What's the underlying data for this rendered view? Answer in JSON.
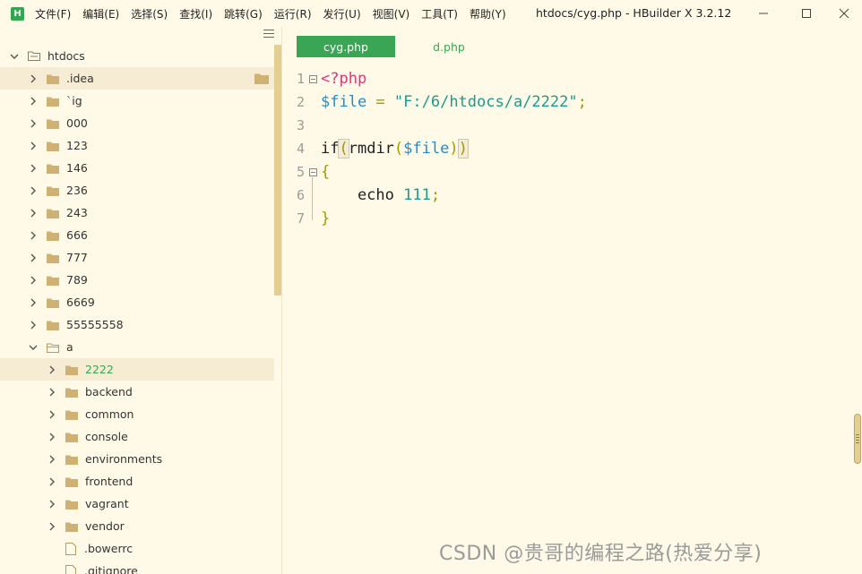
{
  "app": {
    "logo_letter": "H",
    "window_title": "htdocs/cyg.php - HBuilder X 3.2.12",
    "accent_color": "#3aa655"
  },
  "menu": [
    {
      "label": "文件(F)"
    },
    {
      "label": "编辑(E)"
    },
    {
      "label": "选择(S)"
    },
    {
      "label": "查找(I)"
    },
    {
      "label": "跳转(G)"
    },
    {
      "label": "运行(R)"
    },
    {
      "label": "发行(U)"
    },
    {
      "label": "视图(V)"
    },
    {
      "label": "工具(T)"
    },
    {
      "label": "帮助(Y)"
    }
  ],
  "tree": {
    "root": "htdocs",
    "items": [
      {
        "label": ".idea",
        "type": "folder",
        "level": 1,
        "expanded": false,
        "selected": true
      },
      {
        "label": "`ig",
        "type": "folder",
        "level": 1,
        "expanded": false
      },
      {
        "label": "000",
        "type": "folder",
        "level": 1,
        "expanded": false
      },
      {
        "label": "123",
        "type": "folder",
        "level": 1,
        "expanded": false
      },
      {
        "label": "146",
        "type": "folder",
        "level": 1,
        "expanded": false
      },
      {
        "label": "236",
        "type": "folder",
        "level": 1,
        "expanded": false
      },
      {
        "label": "243",
        "type": "folder",
        "level": 1,
        "expanded": false
      },
      {
        "label": "666",
        "type": "folder",
        "level": 1,
        "expanded": false
      },
      {
        "label": "777",
        "type": "folder",
        "level": 1,
        "expanded": false
      },
      {
        "label": "789",
        "type": "folder",
        "level": 1,
        "expanded": false
      },
      {
        "label": "6669",
        "type": "folder",
        "level": 1,
        "expanded": false
      },
      {
        "label": "55555558",
        "type": "folder",
        "level": 1,
        "expanded": false
      },
      {
        "label": "a",
        "type": "folder",
        "level": 1,
        "expanded": true
      },
      {
        "label": "2222",
        "type": "folder",
        "level": 2,
        "expanded": false,
        "highlighted": true
      },
      {
        "label": "backend",
        "type": "folder",
        "level": 2,
        "expanded": false
      },
      {
        "label": "common",
        "type": "folder",
        "level": 2,
        "expanded": false
      },
      {
        "label": "console",
        "type": "folder",
        "level": 2,
        "expanded": false
      },
      {
        "label": "environments",
        "type": "folder",
        "level": 2,
        "expanded": false
      },
      {
        "label": "frontend",
        "type": "folder",
        "level": 2,
        "expanded": false
      },
      {
        "label": "vagrant",
        "type": "folder",
        "level": 2,
        "expanded": false
      },
      {
        "label": "vendor",
        "type": "folder",
        "level": 2,
        "expanded": false
      },
      {
        "label": ".bowerrc",
        "type": "file",
        "level": 2
      },
      {
        "label": ".gitignore",
        "type": "file",
        "level": 2
      }
    ]
  },
  "tabs": [
    {
      "label": "cyg.php",
      "active": true
    },
    {
      "label": "d.php",
      "active": false
    }
  ],
  "code": {
    "line_numbers": [
      "1",
      "2",
      "3",
      "4",
      "5",
      "6",
      "7"
    ],
    "l1": "<?php",
    "l2_var": "$file",
    "l2_eq": " = ",
    "l2_str": "\"F:/6/htdocs/a/2222\"",
    "l2_semi": ";",
    "l4_if": "if",
    "l4_open": "(",
    "l4_fn": "rmdir",
    "l4_fopen": "(",
    "l4_var": "$file",
    "l4_fclose": ")",
    "l4_close": ")",
    "l5": "{",
    "l6_kw": "    echo ",
    "l6_num": "111",
    "l6_semi": ";",
    "l7": "}"
  },
  "watermark": "CSDN @贵哥的编程之路(热爱分享)"
}
